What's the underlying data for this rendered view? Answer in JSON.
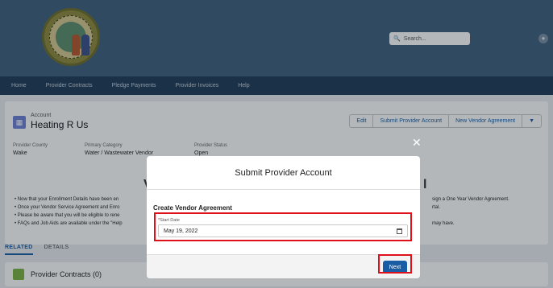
{
  "header": {
    "search_placeholder": "Search...",
    "logo_icon": "nc-state-seal"
  },
  "nav": {
    "items": [
      "Home",
      "Provider Contracts",
      "Pledge Payments",
      "Provider Invoices",
      "Help"
    ]
  },
  "record": {
    "type_label": "Account",
    "name": "Heating R Us",
    "actions": [
      "Edit",
      "Submit Provider Account",
      "New Vendor Agreement"
    ],
    "fields": [
      {
        "label": "Provider County",
        "value": "Wake"
      },
      {
        "label": "Primary Category",
        "value": "Water / Wastewater Vendor"
      },
      {
        "label": "Provider Status",
        "value": "Open"
      }
    ],
    "bullets_left": [
      "• Now that your Enrollment Details have been en",
      "• Once your Vendor Service Agreement and Enro",
      "• Please be aware that you will be eligible to rene",
      "• FAQs and Job Aids are available under the \"Help"
    ],
    "bullets_right": [
      "sign a One Year Vendor Agreement.",
      "rtal.",
      "",
      "may have."
    ],
    "heading_left_char": "V",
    "heading_right_char": "l"
  },
  "tabs": [
    "RELATED",
    "DETAILS"
  ],
  "related": {
    "title": "Provider Contracts (0)"
  },
  "modal": {
    "title": "Submit Provider Account",
    "close_glyph": "✕",
    "section_title": "Create Vendor Agreement",
    "start_date_label": "Start Date",
    "required_mark": "*",
    "start_date_value": "May 19, 2022",
    "next_label": "Next"
  },
  "colors": {
    "header_bg": "#3e5f7e",
    "nav_bg": "#1e3a56",
    "brand_button": "#1b5da4",
    "highlight": "#e0101a"
  }
}
